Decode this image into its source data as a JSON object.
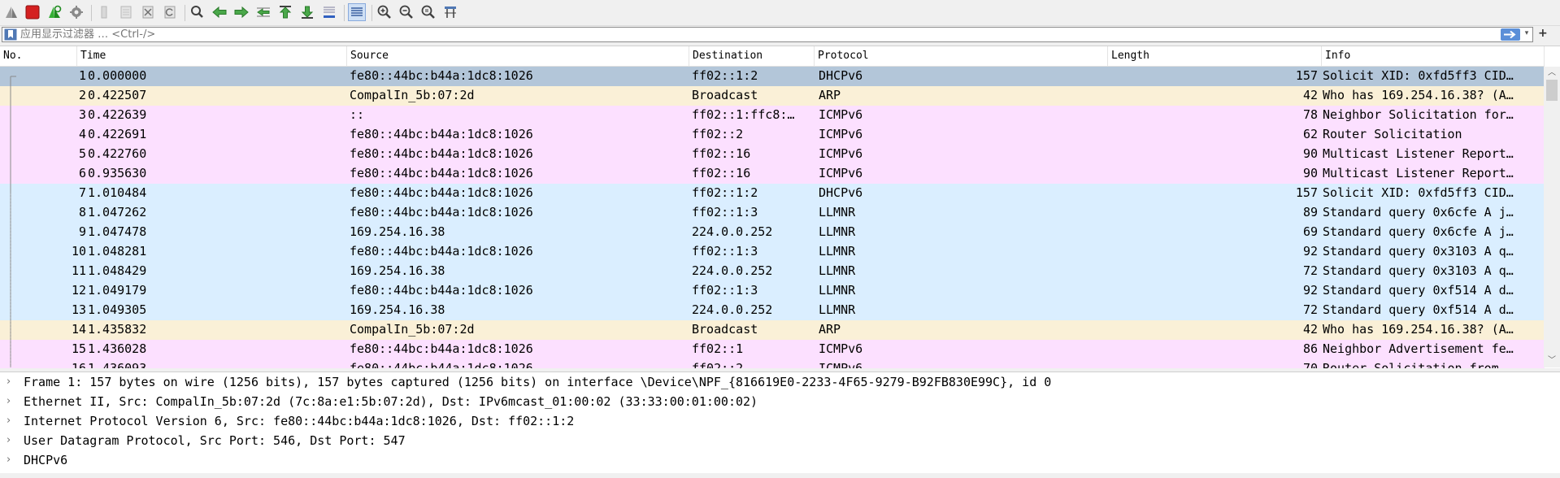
{
  "toolbar": {
    "buttons": [
      {
        "name": "shark-fin-start-icon",
        "color": "#8a8a8a"
      },
      {
        "name": "stop-capture-icon",
        "color": "#d42020"
      },
      {
        "name": "restart-capture-icon",
        "color": "#2aa52a"
      },
      {
        "name": "capture-options-gear-icon",
        "color": "#7a7a7a"
      },
      {
        "name": "open-file-icon",
        "color": "#c0c0c0"
      },
      {
        "name": "save-file-icon",
        "color": "#c0c0c0"
      },
      {
        "name": "close-file-icon",
        "color": "#909090"
      },
      {
        "name": "reload-file-icon",
        "color": "#909090"
      },
      {
        "name": "find-packet-icon",
        "color": "#404040"
      },
      {
        "name": "go-back-icon",
        "color": "#3c9a3c"
      },
      {
        "name": "go-forward-icon",
        "color": "#3c9a3c"
      },
      {
        "name": "go-to-packet-icon",
        "color": "#3c9a3c"
      },
      {
        "name": "go-first-packet-icon",
        "color": "#3c9a3c"
      },
      {
        "name": "go-last-packet-icon",
        "color": "#3c9a3c"
      },
      {
        "name": "auto-scroll-icon",
        "color": "#3c9a3c"
      },
      {
        "name": "colorize-icon",
        "color": "#5078b4"
      },
      {
        "name": "zoom-in-icon",
        "color": "#404040"
      },
      {
        "name": "zoom-out-icon",
        "color": "#404040"
      },
      {
        "name": "zoom-normal-icon",
        "color": "#404040"
      },
      {
        "name": "resize-columns-icon",
        "color": "#5078b4"
      }
    ]
  },
  "filter": {
    "placeholder": "应用显示过滤器 … <Ctrl-/>",
    "value": "",
    "dropdown_glyph": "▾",
    "add_glyph": "+"
  },
  "columns": [
    "No.",
    "Time",
    "Source",
    "Destination",
    "Protocol",
    "Length",
    "Info"
  ],
  "colors": {
    "selected": "#b3c6d9",
    "arp": "#faf0d7",
    "icmpv6": "#fce0ff",
    "udp": "#daeeff"
  },
  "packets": [
    {
      "no": "1",
      "time": "0.000000",
      "src": "fe80::44bc:b44a:1dc8:1026",
      "dst": "ff02::1:2",
      "proto": "DHCPv6",
      "len": "157",
      "info": "Solicit XID: 0xfd5ff3 CID…",
      "color": "selected"
    },
    {
      "no": "2",
      "time": "0.422507",
      "src": "CompalIn_5b:07:2d",
      "dst": "Broadcast",
      "proto": "ARP",
      "len": "42",
      "info": "Who has 169.254.16.38? (A…",
      "color": "arp"
    },
    {
      "no": "3",
      "time": "0.422639",
      "src": "::",
      "dst": "ff02::1:ffc8:…",
      "proto": "ICMPv6",
      "len": "78",
      "info": "Neighbor Solicitation for…",
      "color": "icmpv6"
    },
    {
      "no": "4",
      "time": "0.422691",
      "src": "fe80::44bc:b44a:1dc8:1026",
      "dst": "ff02::2",
      "proto": "ICMPv6",
      "len": "62",
      "info": "Router Solicitation",
      "color": "icmpv6"
    },
    {
      "no": "5",
      "time": "0.422760",
      "src": "fe80::44bc:b44a:1dc8:1026",
      "dst": "ff02::16",
      "proto": "ICMPv6",
      "len": "90",
      "info": "Multicast Listener Report…",
      "color": "icmpv6"
    },
    {
      "no": "6",
      "time": "0.935630",
      "src": "fe80::44bc:b44a:1dc8:1026",
      "dst": "ff02::16",
      "proto": "ICMPv6",
      "len": "90",
      "info": "Multicast Listener Report…",
      "color": "icmpv6"
    },
    {
      "no": "7",
      "time": "1.010484",
      "src": "fe80::44bc:b44a:1dc8:1026",
      "dst": "ff02::1:2",
      "proto": "DHCPv6",
      "len": "157",
      "info": "Solicit XID: 0xfd5ff3 CID…",
      "color": "udp"
    },
    {
      "no": "8",
      "time": "1.047262",
      "src": "fe80::44bc:b44a:1dc8:1026",
      "dst": "ff02::1:3",
      "proto": "LLMNR",
      "len": "89",
      "info": "Standard query 0x6cfe A j…",
      "color": "udp"
    },
    {
      "no": "9",
      "time": "1.047478",
      "src": "169.254.16.38",
      "dst": "224.0.0.252",
      "proto": "LLMNR",
      "len": "69",
      "info": "Standard query 0x6cfe A j…",
      "color": "udp"
    },
    {
      "no": "10",
      "time": "1.048281",
      "src": "fe80::44bc:b44a:1dc8:1026",
      "dst": "ff02::1:3",
      "proto": "LLMNR",
      "len": "92",
      "info": "Standard query 0x3103 A q…",
      "color": "udp"
    },
    {
      "no": "11",
      "time": "1.048429",
      "src": "169.254.16.38",
      "dst": "224.0.0.252",
      "proto": "LLMNR",
      "len": "72",
      "info": "Standard query 0x3103 A q…",
      "color": "udp"
    },
    {
      "no": "12",
      "time": "1.049179",
      "src": "fe80::44bc:b44a:1dc8:1026",
      "dst": "ff02::1:3",
      "proto": "LLMNR",
      "len": "92",
      "info": "Standard query 0xf514 A d…",
      "color": "udp"
    },
    {
      "no": "13",
      "time": "1.049305",
      "src": "169.254.16.38",
      "dst": "224.0.0.252",
      "proto": "LLMNR",
      "len": "72",
      "info": "Standard query 0xf514 A d…",
      "color": "udp"
    },
    {
      "no": "14",
      "time": "1.435832",
      "src": "CompalIn_5b:07:2d",
      "dst": "Broadcast",
      "proto": "ARP",
      "len": "42",
      "info": "Who has 169.254.16.38? (A…",
      "color": "arp"
    },
    {
      "no": "15",
      "time": "1.436028",
      "src": "fe80::44bc:b44a:1dc8:1026",
      "dst": "ff02::1",
      "proto": "ICMPv6",
      "len": "86",
      "info": "Neighbor Advertisement fe…",
      "color": "icmpv6"
    },
    {
      "no": "16",
      "time": "1.436093",
      "src": "fe80::44bc:b44a:1dc8:1026",
      "dst": "ff02::2",
      "proto": "ICMPv6",
      "len": "70",
      "info": "Router Solicitation from…",
      "color": "icmpv6"
    }
  ],
  "details": [
    "Frame 1: 157 bytes on wire (1256 bits), 157 bytes captured (1256 bits) on interface \\Device\\NPF_{816619E0-2233-4F65-9279-B92FB830E99C}, id 0",
    "Ethernet II, Src: CompalIn_5b:07:2d (7c:8a:e1:5b:07:2d), Dst: IPv6mcast_01:00:02 (33:33:00:01:00:02)",
    "Internet Protocol Version 6, Src: fe80::44bc:b44a:1dc8:1026, Dst: ff02::1:2",
    "User Datagram Protocol, Src Port: 546, Dst Port: 547",
    "DHCPv6"
  ],
  "expander_glyph": "›"
}
